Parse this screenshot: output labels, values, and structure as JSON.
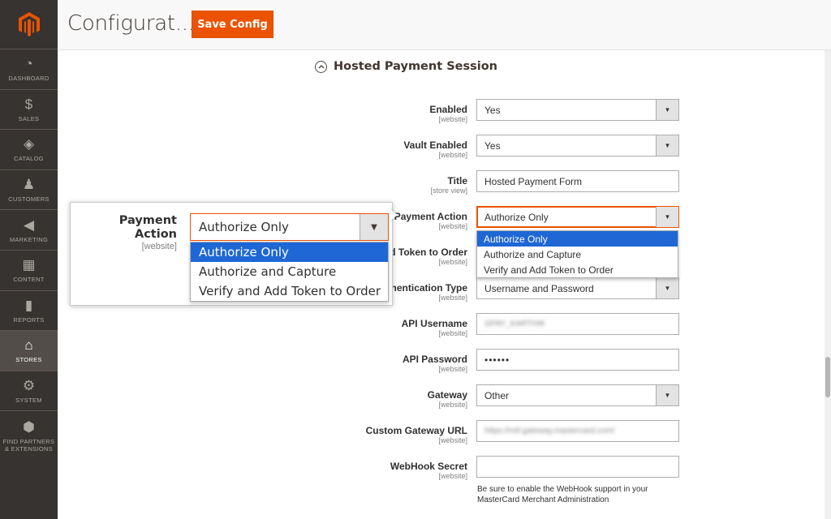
{
  "sidebar": {
    "items": [
      {
        "label": "DASHBOARD",
        "icon": "dashboard-icon",
        "glyph": "◔"
      },
      {
        "label": "SALES",
        "icon": "dollar-icon",
        "glyph": "$"
      },
      {
        "label": "CATALOG",
        "icon": "box-icon",
        "glyph": "◈"
      },
      {
        "label": "CUSTOMERS",
        "icon": "person-icon",
        "glyph": "♟"
      },
      {
        "label": "MARKETING",
        "icon": "megaphone-icon",
        "glyph": "◀"
      },
      {
        "label": "CONTENT",
        "icon": "layout-icon",
        "glyph": "▦"
      },
      {
        "label": "REPORTS",
        "icon": "bar-chart-icon",
        "glyph": "▮"
      },
      {
        "label": "STORES",
        "icon": "store-icon",
        "glyph": "⌂"
      },
      {
        "label": "SYSTEM",
        "icon": "gear-icon",
        "glyph": "⚙"
      },
      {
        "label": "FIND PARTNERS & EXTENSIONS",
        "icon": "cube-icon",
        "glyph": "⬢"
      }
    ],
    "active": "STORES"
  },
  "header": {
    "title": "Configurat...",
    "save_label": "Save Config"
  },
  "section": {
    "title": "Hosted Payment Session",
    "toggle_glyph": "︿"
  },
  "fields": {
    "enabled": {
      "label": "Enabled",
      "scope": "[website]",
      "value": "Yes"
    },
    "vault_enabled": {
      "label": "Vault Enabled",
      "scope": "[website]",
      "value": "Yes"
    },
    "title": {
      "label": "Title",
      "scope": "[store view]",
      "value": "Hosted Payment Form"
    },
    "payment_action": {
      "label": "Payment Action",
      "scope": "[website]",
      "value": "Authorize Only"
    },
    "token_order": {
      "label": "Verify and Add Token to Order",
      "scope": "[website]"
    },
    "auth_type": {
      "label": "API Authentication Type",
      "scope": "[website]",
      "value": "Username and Password"
    },
    "api_username": {
      "label": "API Username",
      "scope": "[website]",
      "value": "GPAY_KARTHIK"
    },
    "api_password": {
      "label": "API Password",
      "scope": "[website]",
      "value": "••••••"
    },
    "gateway": {
      "label": "Gateway",
      "scope": "[website]",
      "value": "Other"
    },
    "custom_gateway_url": {
      "label": "Custom Gateway URL",
      "scope": "[website]",
      "value": "https://mtf.gateway.mastercard.com/"
    },
    "webhook_secret": {
      "label": "WebHook Secret",
      "scope": "[website]",
      "value": "",
      "note": "Be sure to enable the WebHook support in your MasterCard Merchant Administration"
    }
  },
  "payment_action_options": [
    "Authorize Only",
    "Authorize and Capture",
    "Verify and Add Token to Order"
  ],
  "callout": {
    "label": "Payment Action",
    "scope": "[website]",
    "value": "Authorize Only"
  },
  "colors": {
    "accent": "#eb5202",
    "sidebar": "#373330",
    "selected_option": "#1e67d5"
  }
}
